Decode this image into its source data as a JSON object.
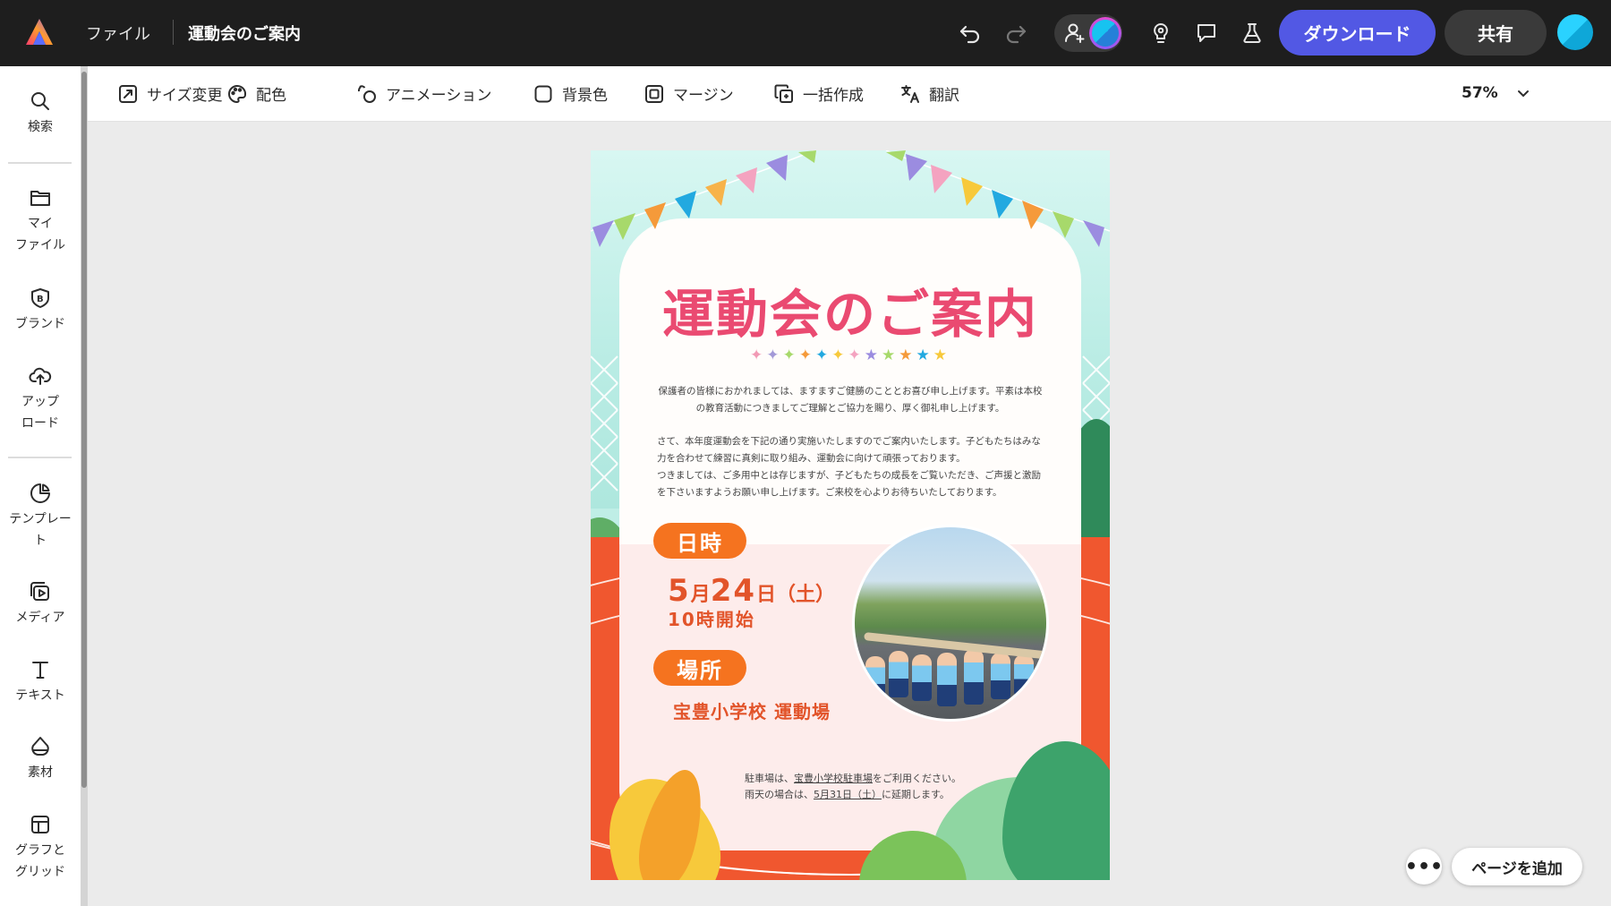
{
  "topbar": {
    "file_menu": "ファイル",
    "doc_title": "運動会のご案内",
    "download_label": "ダウンロード",
    "share_label": "共有",
    "icons": [
      "undo-icon",
      "redo-icon",
      "invite-person-icon",
      "lightbulb-icon",
      "comment-icon",
      "flask-icon"
    ],
    "accent_color": "#5258e4"
  },
  "sidebar": {
    "items": [
      {
        "label": "検索",
        "icon": "search-icon"
      },
      {
        "label": "マイ\nファイル",
        "icon": "folder-icon"
      },
      {
        "label": "ブランド",
        "icon": "brand-icon"
      },
      {
        "label": "アップ\nロード",
        "icon": "upload-cloud-icon"
      },
      {
        "label": "テンプレー\nト",
        "icon": "template-icon"
      },
      {
        "label": "メディア",
        "icon": "media-icon"
      },
      {
        "label": "テキスト",
        "icon": "text-icon"
      },
      {
        "label": "素材",
        "icon": "shapes-icon"
      },
      {
        "label": "グラフと\nグリッド",
        "icon": "grid-icon"
      }
    ]
  },
  "toolbar": {
    "resize": "サイズ変更",
    "color": "配色",
    "animation": "アニメーション",
    "background": "背景色",
    "margin": "マージン",
    "bulk": "一括作成",
    "translate": "翻訳",
    "zoom": "57%"
  },
  "poster": {
    "title": "運動会のご案内",
    "sparkles": "✦✦✦✦✦✦✦★★★★★",
    "greeting": "保護者の皆様におかれましては、ますますご健勝のこととお喜び申し上げます。平素は本校の教育活動につきましてご理解とご協力を賜り、厚く御礼申し上げます。",
    "body1": "さて、本年度運動会を下記の通り実施いたしますのでご案内いたします。子どもたちはみな力を合わせて練習に真剣に取り組み、運動会に向けて頑張っております。",
    "body2": "つきましては、ご多用中とは存じますが、子どもたちの成長をご覧いただき、ご声援と激励を下さいますようお願い申し上げます。ご来校を心よりお待ちいたしております。",
    "date_heading": "日時",
    "date_month": "5",
    "date_month_unit": "月",
    "date_day": "24",
    "date_day_unit": "日",
    "date_weekday": "（土）",
    "time": "10時開始",
    "venue_heading": "場所",
    "venue": "宝豊小学校 運動場",
    "parking_prefix": "駐車場は、",
    "parking_link": "宝豊小学校駐車場",
    "parking_suffix": "をご利用ください。",
    "rain_prefix": "雨天の場合は、",
    "rain_link": "5月31日（土）",
    "rain_suffix": "に延期します。"
  },
  "bottom": {
    "more": "•••",
    "add_page": "ページを追加"
  }
}
